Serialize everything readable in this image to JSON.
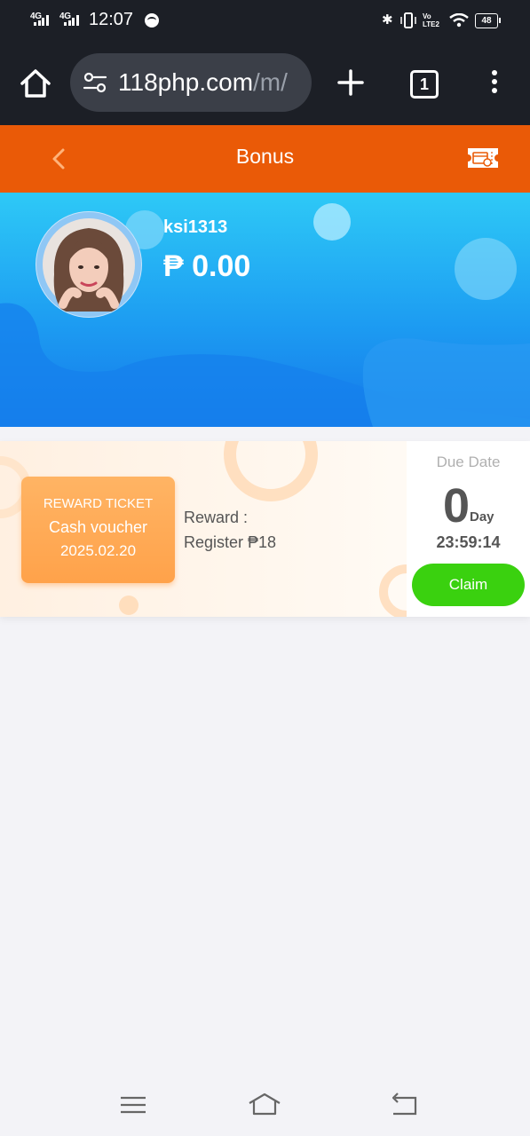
{
  "status_bar": {
    "network_1": "4G",
    "network_2": "4G",
    "time": "12:07",
    "volte": "Vo LTE2",
    "battery": "48"
  },
  "browser": {
    "url_host": "118php.com",
    "url_path": "/m/",
    "tab_count": "1"
  },
  "header": {
    "title": "Bonus"
  },
  "profile": {
    "username": "ksi1313",
    "balance": "₱ 0.00"
  },
  "reward_card": {
    "ticket_type": "REWARD TICKET",
    "ticket_name": "Cash voucher",
    "ticket_date": "2025.02.20",
    "reward_label": "Reward :",
    "reward_value": "Register ₱18",
    "due_label": "Due Date",
    "due_days": "0",
    "due_unit": "Day",
    "due_time": "23:59:14",
    "claim_label": "Claim"
  },
  "colors": {
    "header_orange": "#ea5a07",
    "banner_blue": "#1d9df2",
    "voucher_orange": "#ffa24a",
    "claim_green": "#3ad10f"
  },
  "icons": {
    "home": "home-icon",
    "tune": "page-info-icon",
    "new_tab": "plus-icon",
    "menu": "more-vertical-icon",
    "back": "chevron-left-icon",
    "ticket": "ticket-icon",
    "nav_menu": "menu-icon",
    "nav_home": "home-outline-icon",
    "nav_back": "back-icon"
  }
}
